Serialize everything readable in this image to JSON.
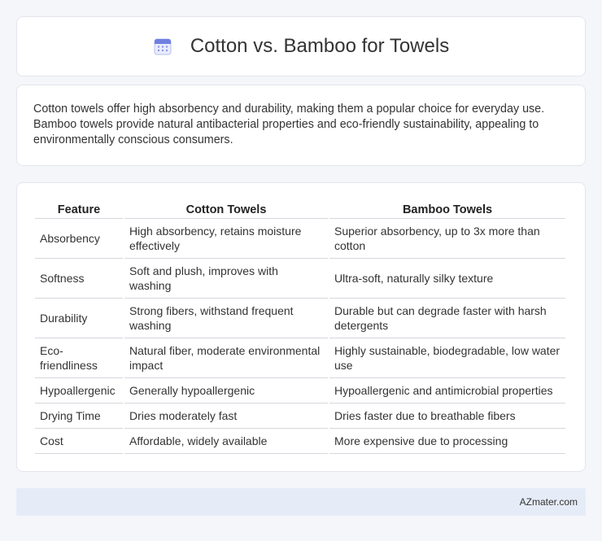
{
  "header": {
    "title": "Cotton vs. Bamboo for Towels",
    "icon": "calendar-icon",
    "icon_color": "#7a86e0"
  },
  "intro": {
    "text": "Cotton towels offer high absorbency and durability, making them a popular choice for everyday use. Bamboo towels provide natural antibacterial properties and eco-friendly sustainability, appealing to environmentally conscious consumers."
  },
  "table": {
    "headers": [
      "Feature",
      "Cotton Towels",
      "Bamboo Towels"
    ],
    "rows": [
      [
        "Absorbency",
        "High absorbency, retains moisture effectively",
        "Superior absorbency, up to 3x more than cotton"
      ],
      [
        "Softness",
        "Soft and plush, improves with washing",
        "Ultra-soft, naturally silky texture"
      ],
      [
        "Durability",
        "Strong fibers, withstand frequent washing",
        "Durable but can degrade faster with harsh detergents"
      ],
      [
        "Eco-friendliness",
        "Natural fiber, moderate environmental impact",
        "Highly sustainable, biodegradable, low water use"
      ],
      [
        "Hypoallergenic",
        "Generally hypoallergenic",
        "Hypoallergenic and antimicrobial properties"
      ],
      [
        "Drying Time",
        "Dries moderately fast",
        "Dries faster due to breathable fibers"
      ],
      [
        "Cost",
        "Affordable, widely available",
        "More expensive due to processing"
      ]
    ]
  },
  "footer": {
    "text": "AZmater.com"
  }
}
